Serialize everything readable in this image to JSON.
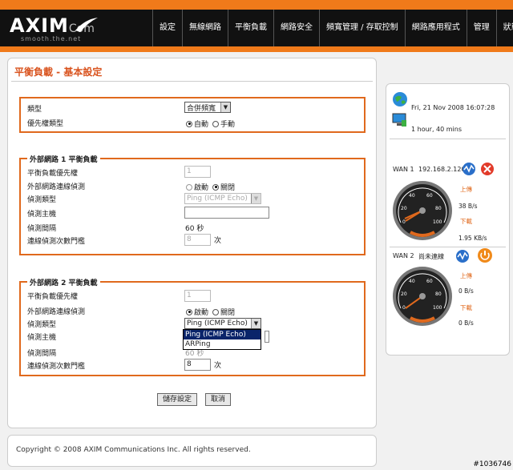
{
  "brand": {
    "name": "AXIM",
    "suffix": "Com",
    "tagline": "smooth.the.net"
  },
  "nav": [
    "設定",
    "無線網路",
    "平衡負載",
    "網路安全",
    "頻寬管理 / 存取控制",
    "網路應用程式",
    "管理",
    "狀態"
  ],
  "page_title": "平衡負載 - 基本設定",
  "general": {
    "type_label": "類型",
    "type_value": "合併頻寬",
    "priority_type_label": "優先權類型",
    "opt_auto": "自動",
    "opt_manual": "手動"
  },
  "wan1": {
    "legend": "外部網路 1 平衡負載",
    "priority_label": "平衡負載優先權",
    "priority_value": "1",
    "detect_label": "外部網路連線偵測",
    "opt_on": "啟動",
    "opt_off": "關閉",
    "detect_type_label": "偵測類型",
    "detect_type_value": "Ping (ICMP Echo)",
    "host_label": "偵測主機",
    "host_value": "",
    "interval_label": "偵測間隔",
    "interval_value": "60 秒",
    "threshold_label": "連線偵測次數門檻",
    "threshold_value": "8",
    "threshold_unit": "次"
  },
  "wan2": {
    "legend": "外部網路 2 平衡負載",
    "priority_label": "平衡負載優先權",
    "priority_value": "1",
    "detect_label": "外部網路連線偵測",
    "opt_on": "啟動",
    "opt_off": "關閉",
    "detect_type_label": "偵測類型",
    "detect_type_value": "Ping (ICMP Echo)",
    "host_label": "偵測主機",
    "interval_label": "偵測間隔",
    "interval_value": "60 秒",
    "threshold_label": "連線偵測次數門檻",
    "threshold_value": "8",
    "threshold_unit": "次",
    "dropdown_options": [
      "Ping (ICMP Echo)",
      "ARPing"
    ]
  },
  "buttons": {
    "save": "儲存設定",
    "cancel": "取消"
  },
  "footer": "Copyright © 2008 AXIM Communications Inc. All rights reserved.",
  "status": {
    "datetime": "Fri, 21 Nov 2008 16:07:28",
    "uptime": "1 hour, 40 mins",
    "wan1_label": "WAN 1",
    "wan1_ip": "192.168.2.120",
    "wan1_up_label": "上傳",
    "wan1_up_value": "38 B/s",
    "wan1_down_label": "下載",
    "wan1_down_value": "1.95 KB/s",
    "wan2_label": "WAN 2",
    "wan2_status": "尚未連線",
    "wan2_up_label": "上傳",
    "wan2_up_value": "0 B/s",
    "wan2_down_label": "下載",
    "wan2_down_value": "0 B/s",
    "gauge_ticks": [
      "0",
      "20",
      "40",
      "60",
      "80",
      "100"
    ]
  },
  "watermark": "#1036746"
}
